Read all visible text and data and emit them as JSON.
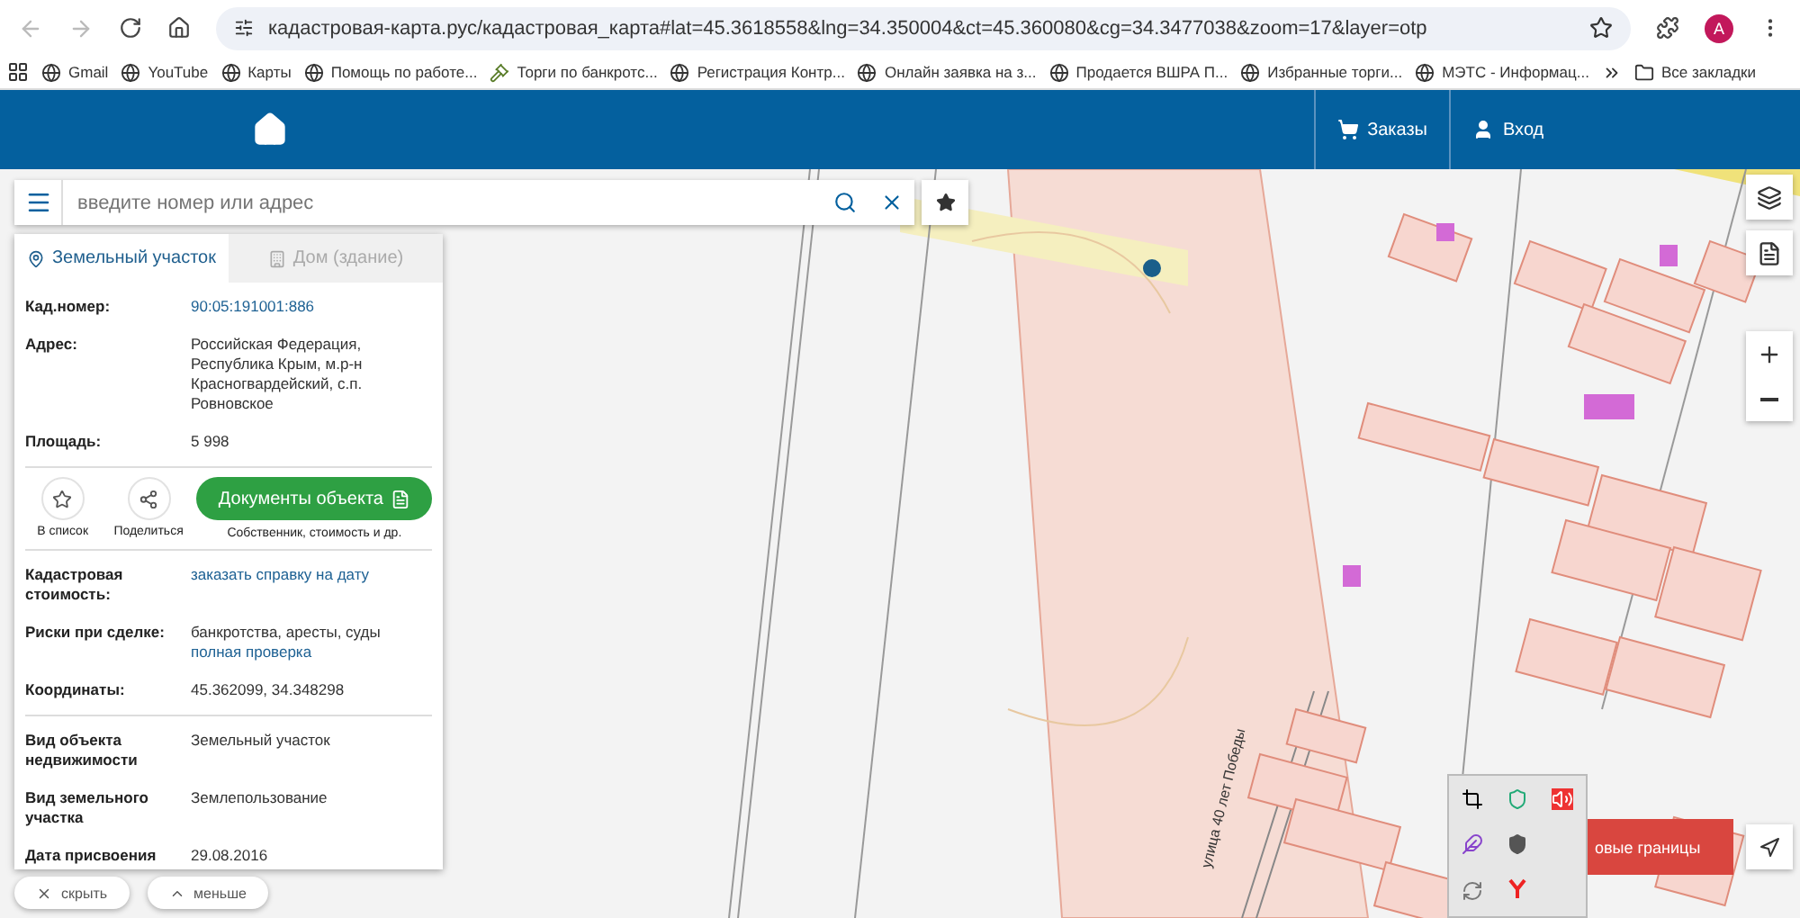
{
  "browser": {
    "url": "кадастровая-карта.рус/кадастровая_карта#lat=45.3618558&lng=34.350004&ct=45.360080&cg=34.3477038&zoom=17&layer=otp",
    "profile_initial": "A",
    "bookmarks": [
      {
        "label": "Gmail",
        "kind": "globe"
      },
      {
        "label": "YouTube",
        "kind": "globe"
      },
      {
        "label": "Карты",
        "kind": "globe"
      },
      {
        "label": "Помощь по работе...",
        "kind": "globe"
      },
      {
        "label": "Торги по банкротс...",
        "kind": "gavel"
      },
      {
        "label": "Регистрация Контр...",
        "kind": "globe"
      },
      {
        "label": "Онлайн заявка на з...",
        "kind": "globe"
      },
      {
        "label": "Продается ВШРА П...",
        "kind": "globe"
      },
      {
        "label": "Избранные торги...",
        "kind": "globe"
      },
      {
        "label": "МЭТС - Информац...",
        "kind": "globe"
      }
    ],
    "all_bookmarks": "Все закладки"
  },
  "header": {
    "orders": "Заказы",
    "login": "Вход"
  },
  "search": {
    "placeholder": "введите номер или адрес"
  },
  "panel": {
    "tabs": [
      {
        "label": "Земельный участок",
        "selected": true
      },
      {
        "label": "Дом (здание)",
        "selected": false
      }
    ],
    "sections": [
      [
        {
          "label": "Кад.номер:",
          "value": "90:05:191001:886",
          "kind": "link"
        },
        {
          "label": "Адрес:",
          "value": "Российская Федерация, Республика Крым, м.р-н Красногвардейский, с.п. Ровновское",
          "kind": "text"
        },
        {
          "label": "Площадь:",
          "value": "5 998",
          "kind": "text"
        }
      ],
      [
        {
          "label": "Кадастровая стоимость:",
          "value": "заказать справку на дату",
          "kind": "link"
        },
        {
          "label": "Риски при сделке:",
          "value": "банкротства, аресты, суды",
          "link": "полная проверка",
          "kind": "text"
        },
        {
          "label": "Координаты:",
          "value": "45.362099, 34.348298",
          "kind": "text"
        }
      ],
      [
        {
          "label": "Вид объекта недвижимости",
          "value": "Земельный участок",
          "kind": "text"
        },
        {
          "label": "Вид земельного участка",
          "value": "Землепользование",
          "kind": "text"
        },
        {
          "label": "Дата присвоения",
          "value": "29.08.2016",
          "kind": "text"
        }
      ]
    ],
    "actions": [
      {
        "label": "В список",
        "kind": "star"
      },
      {
        "label": "Поделиться",
        "kind": "share"
      }
    ],
    "documents": {
      "label": "Документы объекта",
      "caption": "Собственник, стоимость и др."
    },
    "footer_buttons": [
      {
        "label": "скрыть",
        "kind": "close"
      },
      {
        "label": "меньше",
        "kind": "up"
      }
    ]
  },
  "map": {
    "street_label": "улица 40 лет Победы",
    "boundary_button": "овые границы"
  }
}
